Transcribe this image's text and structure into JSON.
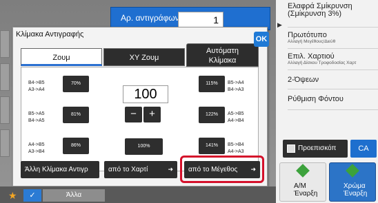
{
  "copies": {
    "label": "Αρ. αντιγράφων",
    "value": "1"
  },
  "right_panel": {
    "rows": [
      {
        "title": "Ελαφρά Σμίκρυνση (Σμίκρυνση 3%)",
        "sub": ""
      },
      {
        "title": "Πρωτότυπο",
        "sub": "Αλλαγή Μεγέθους/Διεύθ"
      },
      {
        "title": "Επιλ. Χαρτιού",
        "sub": "Αλλαγή Δίσκου Τροφοδοσίας Χαρτ"
      },
      {
        "title": "2-Όψεων",
        "sub": ""
      },
      {
        "title": "Ρύθμιση Φόντου",
        "sub": ""
      }
    ],
    "preview_label": "Προεπισκόπ",
    "ca_label": "CA",
    "start_bw": "Α/Μ Έναρξη",
    "start_color": "Χρώμα Έναρξη"
  },
  "dialog": {
    "title": "Κλίμακα Αντιγραφής",
    "ok_label": "OK",
    "tabs": {
      "zoom": "Ζουμ",
      "xy": "XY Ζουμ",
      "auto_l1": "Αυτόματη",
      "auto_l2": "Κλίμακα"
    },
    "value": "100",
    "minus": "−",
    "plus": "+",
    "presets_left": [
      {
        "l1": "B4->B5",
        "l2": "A3->A4",
        "btn": "70%"
      },
      {
        "l1": "B5->A5",
        "l2": "B4->A5",
        "btn": "81%"
      },
      {
        "l1": "A4->B5",
        "l2": "A3->B4",
        "btn": "86%"
      }
    ],
    "preset_100": "100%",
    "presets_right": [
      {
        "btn": "115%",
        "l1": "B5->A4",
        "l2": "B4->A3"
      },
      {
        "btn": "122%",
        "l1": "A5->B5",
        "l2": "A4->B4"
      },
      {
        "btn": "141%",
        "l1": "B5->B4",
        "l2": "A4->A3"
      }
    ],
    "bottom_buttons": {
      "other_scale": "Άλλη Κλίμακα Αντιγρ",
      "from_paper": "από το Χαρτί",
      "from_size": "από το Μέγεθος"
    }
  },
  "bottom_bar": {
    "other": "Άλλα"
  }
}
